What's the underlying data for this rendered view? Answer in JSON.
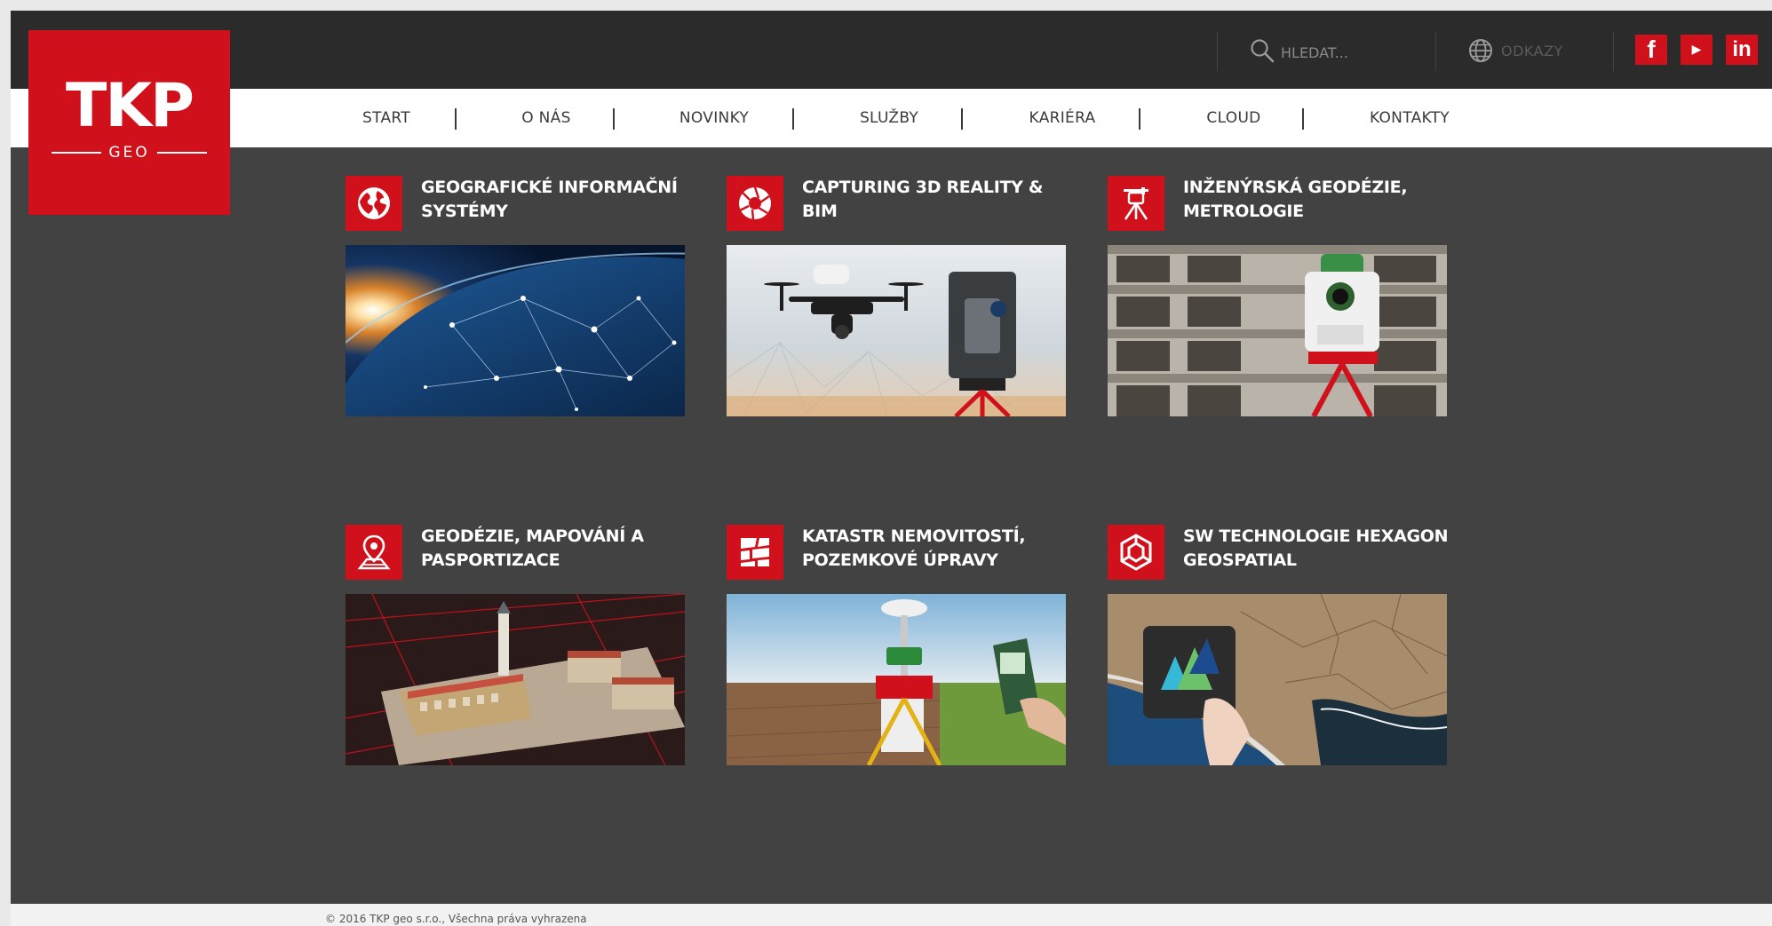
{
  "logo": {
    "main": "TKP",
    "sub": "GEO"
  },
  "search": {
    "placeholder": "HLEDAT..."
  },
  "links": {
    "label": "ODKAZY"
  },
  "social": {
    "facebook": "f",
    "youtube": "▶",
    "linkedin": "in"
  },
  "nav": {
    "items": [
      {
        "label": "START"
      },
      {
        "label": "O NÁS"
      },
      {
        "label": "NOVINKY"
      },
      {
        "label": "SLUŽBY"
      },
      {
        "label": "KARIÉRA"
      },
      {
        "label": "CLOUD"
      },
      {
        "label": "KONTAKTY"
      }
    ]
  },
  "tiles": [
    {
      "title": "GEOGRAFICKÉ INFORMAČNÍ SYSTÉMY",
      "icon": "globe-icon",
      "image": "earth-network-image"
    },
    {
      "title": "CAPTURING 3D REALITY & BIM",
      "icon": "camera-aperture-icon",
      "image": "drone-laser-scanner-image"
    },
    {
      "title": "INŽENÝRSKÁ GEODÉZIE, METROLOGIE",
      "icon": "total-station-icon",
      "image": "total-station-building-image"
    },
    {
      "title": "GEODÉZIE, MAPOVÁNÍ A PASPORTIZACE",
      "icon": "map-pin-icon",
      "image": "town-square-aerial-image"
    },
    {
      "title": "KATASTR NEMOVITOSTÍ, POZEMKOVÉ ÚPRAVY",
      "icon": "parcel-map-icon",
      "image": "gnss-receiver-field-image"
    },
    {
      "title": "SW TECHNOLOGIE HEXAGON GEOSPATIAL",
      "icon": "hexagon-logo-icon",
      "image": "hexagon-tablet-image"
    }
  ],
  "footer": {
    "copyright": "© 2016 TKP geo s.r.o., Všechna práva vyhrazena"
  },
  "colors": {
    "brand_red": "#d0111b",
    "topbar": "#2b2b2b",
    "content_bg": "#424242",
    "nav_bg": "#ffffff"
  }
}
